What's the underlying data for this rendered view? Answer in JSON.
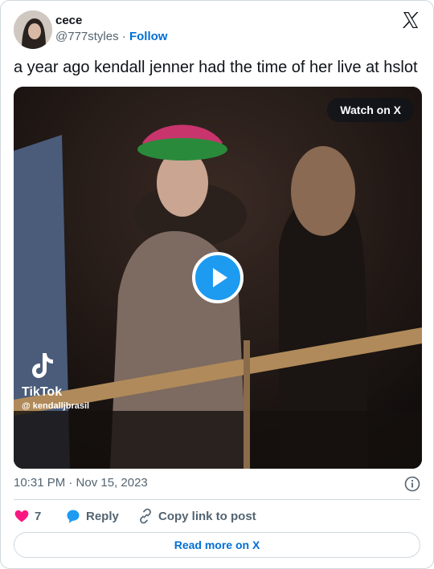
{
  "author": {
    "name": "cece",
    "handle": "@777styles",
    "separator": "·",
    "follow_label": "Follow"
  },
  "tweet": {
    "text": "a year ago kendall jenner had the time of her live at hslot"
  },
  "media": {
    "watch_label": "Watch on X",
    "tiktok_brand": "TikTok",
    "tiktok_user": "@ kendalljbrasil"
  },
  "meta": {
    "timestamp": "10:31 PM · Nov 15, 2023"
  },
  "actions": {
    "like_count": "7",
    "reply_label": "Reply",
    "copy_label": "Copy link to post"
  },
  "footer": {
    "read_more_label": "Read more on X"
  },
  "colors": {
    "accent": "#1d9bf0",
    "link": "#006fd6",
    "like": "#f91880",
    "muted": "#536471"
  },
  "icons": [
    "x-logo-icon",
    "play-icon",
    "tiktok-icon",
    "info-icon",
    "heart-icon",
    "reply-bubble-icon",
    "link-icon"
  ]
}
